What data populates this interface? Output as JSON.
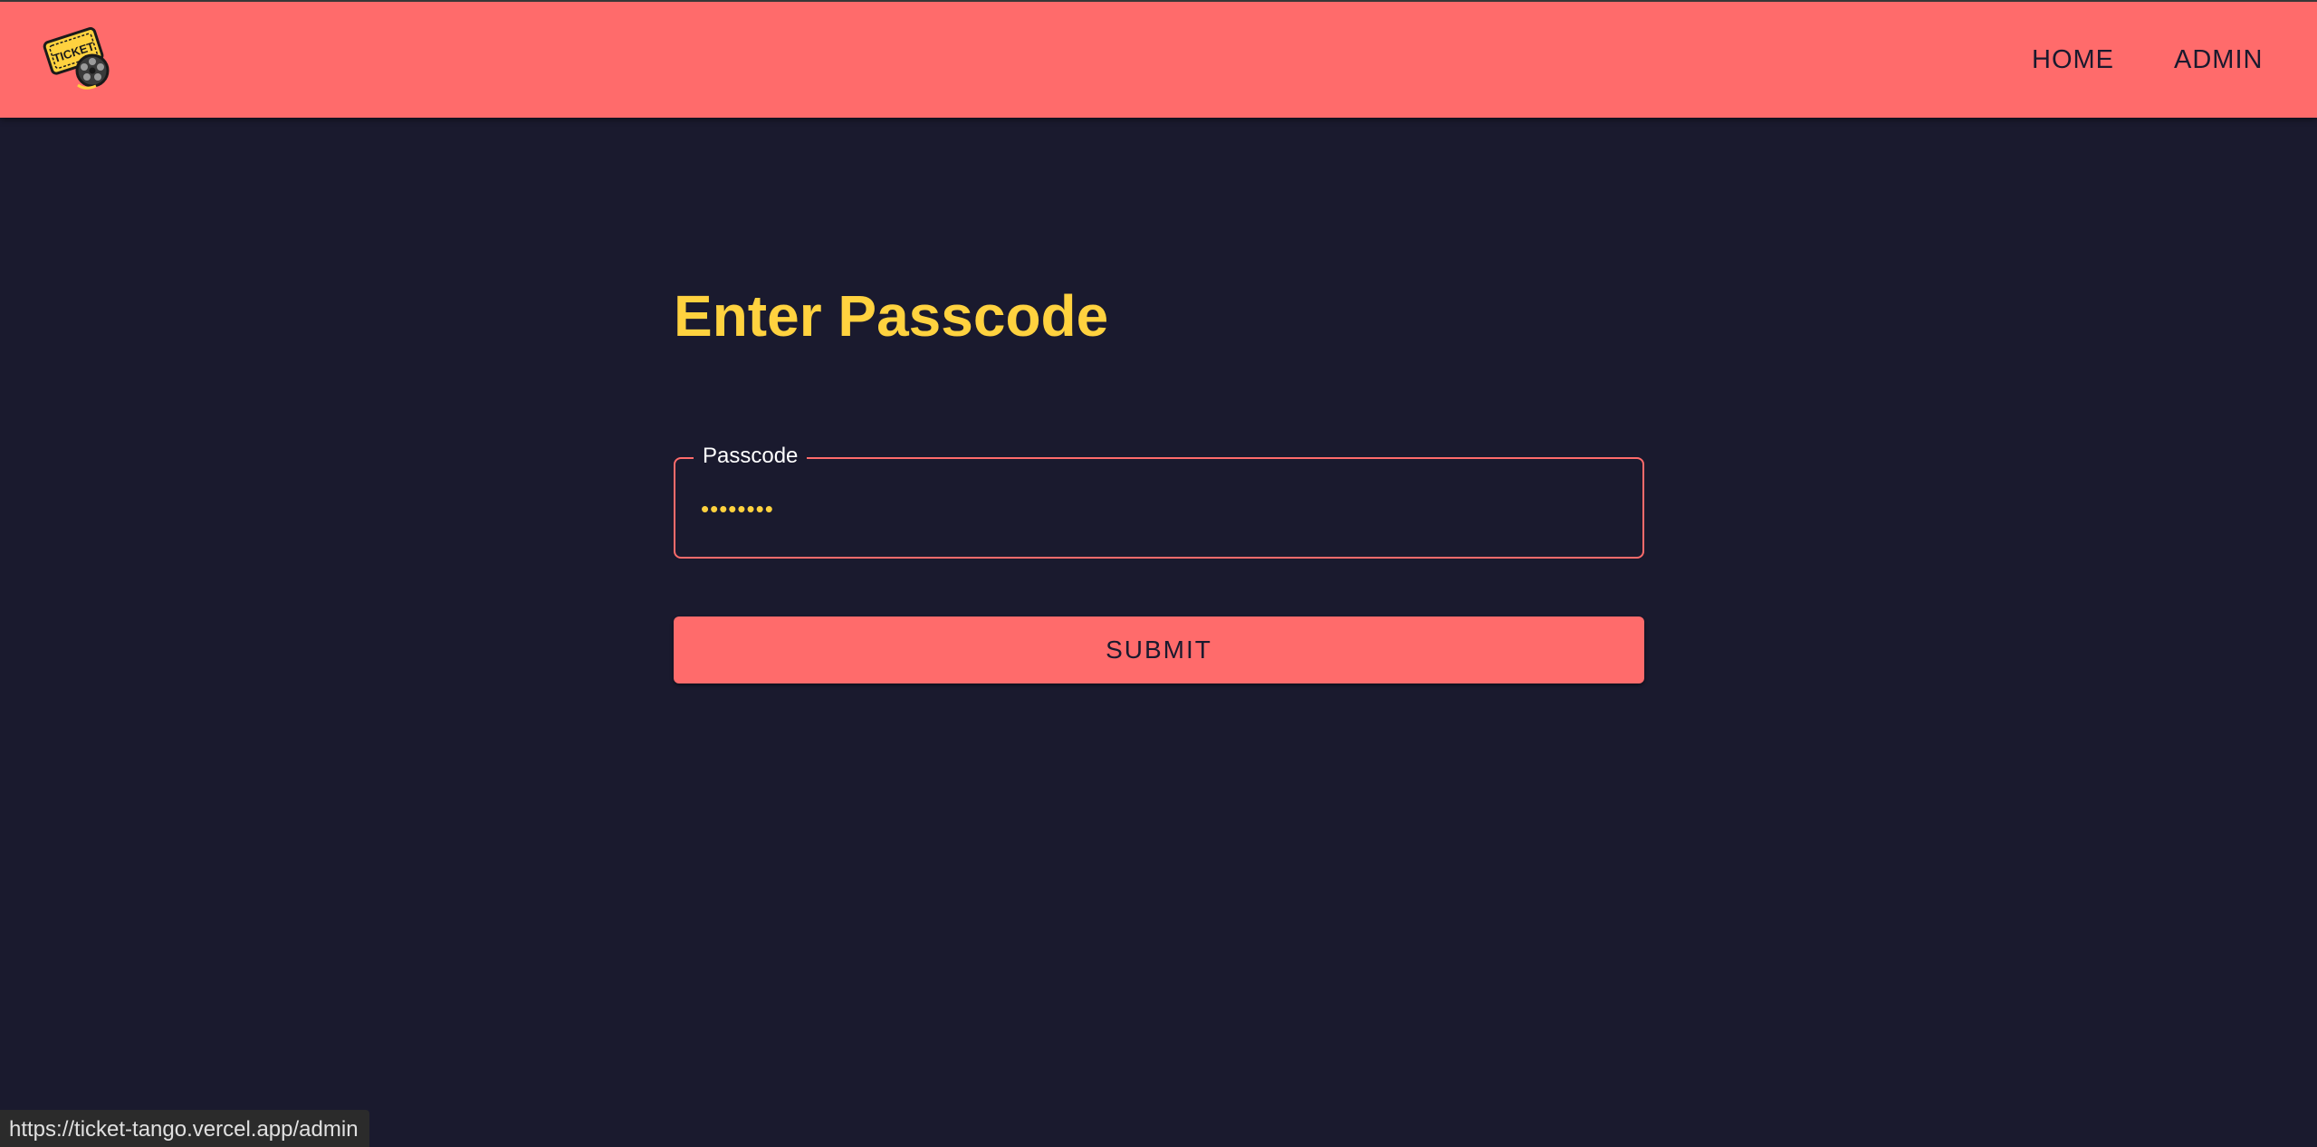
{
  "nav": {
    "logo_icon": "ticket-film-reel-logo-icon",
    "logo_text": "TICKET",
    "links": [
      "HOME",
      "ADMIN"
    ]
  },
  "main": {
    "title": "Enter Passcode",
    "passcode_field": {
      "label": "Passcode",
      "value": "••••••••"
    },
    "submit_label": "SUBMIT"
  },
  "status_bar": {
    "url": "https://ticket-tango.vercel.app/admin"
  },
  "colors": {
    "navbar": "#ff6b6b",
    "background": "#1a1a2e",
    "accent_yellow": "#ffd23f",
    "button": "#ff6b6b"
  }
}
